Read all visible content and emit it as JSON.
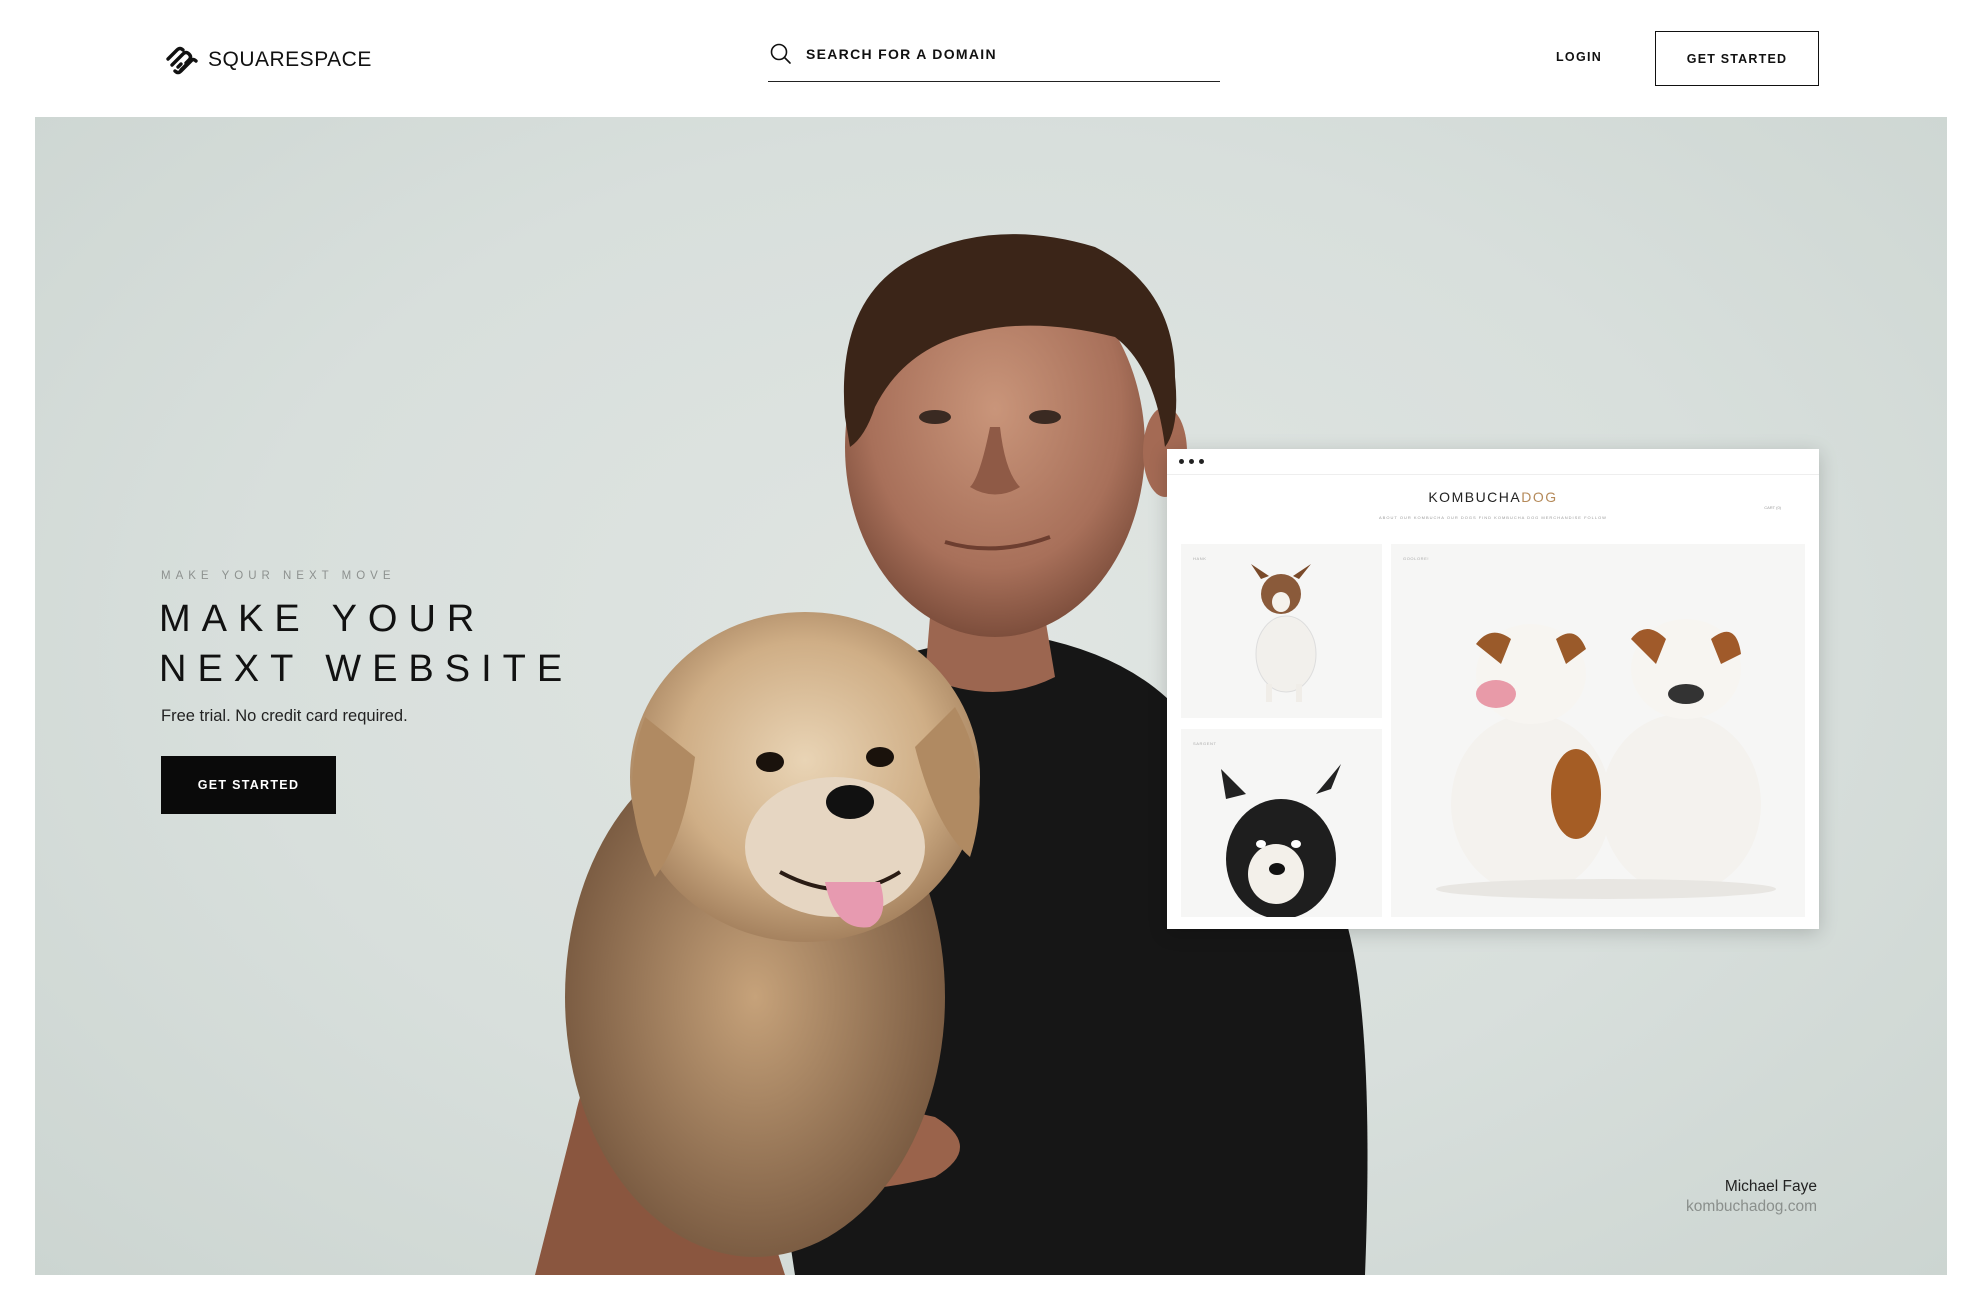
{
  "header": {
    "logo_text": "SQUARESPACE",
    "search_placeholder": "SEARCH FOR A DOMAIN",
    "login_label": "LOGIN",
    "cta_label": "GET STARTED"
  },
  "hero": {
    "eyebrow": "MAKE YOUR NEXT MOVE",
    "headline_line1": "MAKE YOUR",
    "headline_line2": "NEXT WEBSITE",
    "subhead": "Free trial. No credit card required.",
    "cta_label": "GET STARTED",
    "background_color": "#d8dfdc"
  },
  "preview": {
    "brand_main": "KOMBUCHA",
    "brand_accent": "DOG",
    "accent_color": "#b58a5a",
    "nav_text": "ABOUT   OUR KOMBUCHA   OUR DOGS   FIND KOMBUCHA DOG   MERCHANDISE   FOLLOW",
    "cart_text": "CART (0)",
    "tiles": [
      {
        "label": "HANK"
      },
      {
        "label": "GOOLORE!"
      },
      {
        "label": "SARGENT"
      }
    ]
  },
  "credit": {
    "name": "Michael Faye",
    "url": "kombuchadog.com"
  },
  "colors": {
    "brand_black": "#0a0a0a",
    "accent_brown": "#b58a5a"
  }
}
